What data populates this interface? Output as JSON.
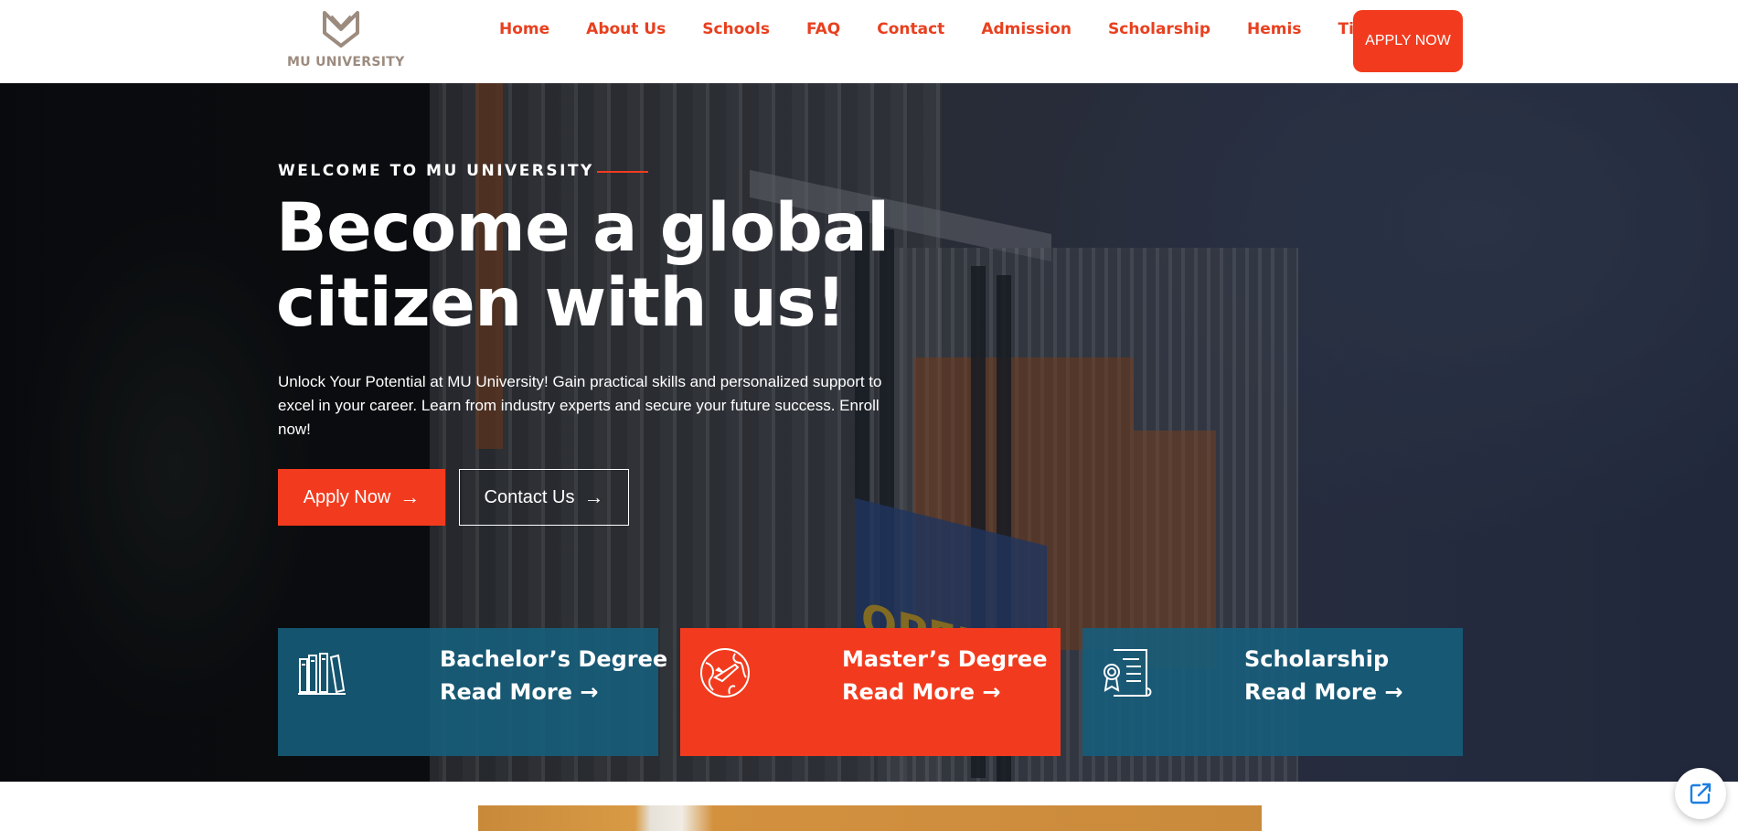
{
  "brand": {
    "name": "MU UNIVERSITY",
    "accent": "#f23b1e",
    "teal": "#165e7c"
  },
  "nav": {
    "items": [
      "Home",
      "About Us",
      "Schools",
      "FAQ",
      "Contact",
      "Admission",
      "Scholarship",
      "Hemis",
      "Timetable"
    ],
    "cta": "APPLY NOW"
  },
  "hero": {
    "eyebrow": "WELCOME TO MU UNIVERSITY",
    "headline_line1": "Become a global",
    "headline_line2": "citizen with us!",
    "lede": "Unlock Your Potential at MU University! Gain practical skills and personalized support to excel in your career. Learn from industry experts and secure your future success. Enroll now!",
    "apply_label": "Apply Now",
    "contact_label": "Contact Us",
    "banner_text": "OPEN!"
  },
  "cards": [
    {
      "title": "Bachelor’s Degree",
      "more": "Read More",
      "icon": "books-icon"
    },
    {
      "title": "Master’s Degree",
      "more": "Read More",
      "icon": "globe-plane-icon"
    },
    {
      "title": "Scholarship",
      "more": "Read More",
      "icon": "certificate-icon"
    }
  ],
  "floating": {
    "icon": "external-link-icon"
  }
}
